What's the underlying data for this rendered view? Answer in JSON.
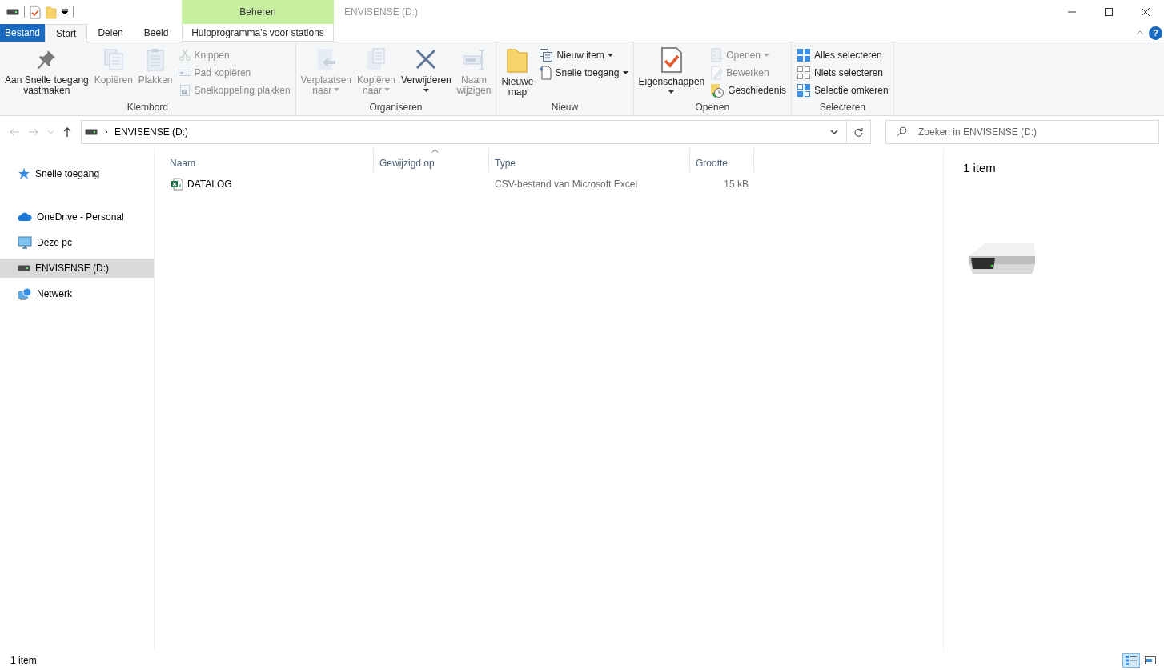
{
  "window": {
    "title": "ENVISENSE (D:)",
    "context_group": "Beheren",
    "help_label": "?"
  },
  "ribbon_tabs": [
    {
      "label": "Bestand",
      "kind": "file",
      "selected": false
    },
    {
      "label": "Start",
      "kind": "normal",
      "selected": true
    },
    {
      "label": "Delen",
      "kind": "normal",
      "selected": false
    },
    {
      "label": "Beeld",
      "kind": "normal",
      "selected": false
    },
    {
      "label": "Hulpprogramma's voor stations",
      "kind": "context",
      "selected": false
    }
  ],
  "ribbon_groups": [
    {
      "label": "Klembord",
      "items": [
        {
          "kind": "large",
          "label": "Aan Snelle toegang\nvastmaken",
          "disabled": false,
          "dropdown": false
        },
        {
          "kind": "large",
          "label": "Kopiëren",
          "disabled": true,
          "dropdown": false
        },
        {
          "kind": "large",
          "label": "Plakken",
          "disabled": true,
          "dropdown": false
        },
        {
          "kind": "small",
          "label": "Knippen",
          "disabled": true,
          "dropdown": false
        },
        {
          "kind": "small",
          "label": "Pad kopiëren",
          "disabled": true,
          "dropdown": false
        },
        {
          "kind": "small",
          "label": "Snelkoppeling plakken",
          "disabled": true,
          "dropdown": false
        }
      ]
    },
    {
      "label": "Organiseren",
      "items": [
        {
          "kind": "large",
          "label": "Verplaatsen\nnaar",
          "disabled": true,
          "dropdown": true
        },
        {
          "kind": "large",
          "label": "Kopiëren\nnaar",
          "disabled": true,
          "dropdown": true
        },
        {
          "kind": "large",
          "label": "Verwijderen",
          "disabled": false,
          "dropdown": true
        },
        {
          "kind": "large",
          "label": "Naam\nwijzigen",
          "disabled": true,
          "dropdown": false
        }
      ]
    },
    {
      "label": "Nieuw",
      "items": [
        {
          "kind": "large",
          "label": "Nieuwe\nmap",
          "disabled": false,
          "dropdown": false
        },
        {
          "kind": "small",
          "label": "Nieuw item",
          "disabled": false,
          "dropdown": true
        },
        {
          "kind": "small",
          "label": "Snelle toegang",
          "disabled": false,
          "dropdown": true
        }
      ]
    },
    {
      "label": "Openen",
      "items": [
        {
          "kind": "large",
          "label": "Eigenschappen",
          "disabled": false,
          "dropdown": true
        },
        {
          "kind": "small",
          "label": "Openen",
          "disabled": true,
          "dropdown": true
        },
        {
          "kind": "small",
          "label": "Bewerken",
          "disabled": true,
          "dropdown": false
        },
        {
          "kind": "small",
          "label": "Geschiedenis",
          "disabled": false,
          "dropdown": false
        }
      ]
    },
    {
      "label": "Selecteren",
      "items": [
        {
          "kind": "small",
          "label": "Alles selecteren",
          "disabled": false,
          "dropdown": false
        },
        {
          "kind": "small",
          "label": "Niets selecteren",
          "disabled": false,
          "dropdown": false
        },
        {
          "kind": "small",
          "label": "Selectie omkeren",
          "disabled": false,
          "dropdown": false
        }
      ]
    }
  ],
  "address_bar": {
    "path": "ENVISENSE (D:)",
    "back_disabled": true,
    "forward_disabled": true
  },
  "search": {
    "placeholder": "Zoeken in ENVISENSE (D:)"
  },
  "nav_sections": [
    [
      {
        "label": "Snelle toegang",
        "selected": false
      }
    ],
    [
      {
        "label": "OneDrive - Personal",
        "selected": false
      },
      {
        "label": "Deze pc",
        "selected": false
      },
      {
        "label": "ENVISENSE (D:)",
        "selected": true
      },
      {
        "label": "Netwerk",
        "selected": false
      }
    ]
  ],
  "file_list": {
    "columns": [
      {
        "label": "Naam",
        "sorted": false
      },
      {
        "label": "Gewijzigd op",
        "sorted": true
      },
      {
        "label": "Type",
        "sorted": false
      },
      {
        "label": "Grootte",
        "sorted": false
      }
    ],
    "rows": [
      {
        "name": "DATALOG",
        "type": "CSV-bestand van Microsoft Excel",
        "size": "15 kB",
        "selected": false
      }
    ]
  },
  "details_pane": {
    "summary": "1 item"
  },
  "status_bar": {
    "text": "1 item",
    "views": [
      {
        "kind": "details",
        "selected": true
      },
      {
        "kind": "large-icons",
        "selected": false
      }
    ]
  }
}
